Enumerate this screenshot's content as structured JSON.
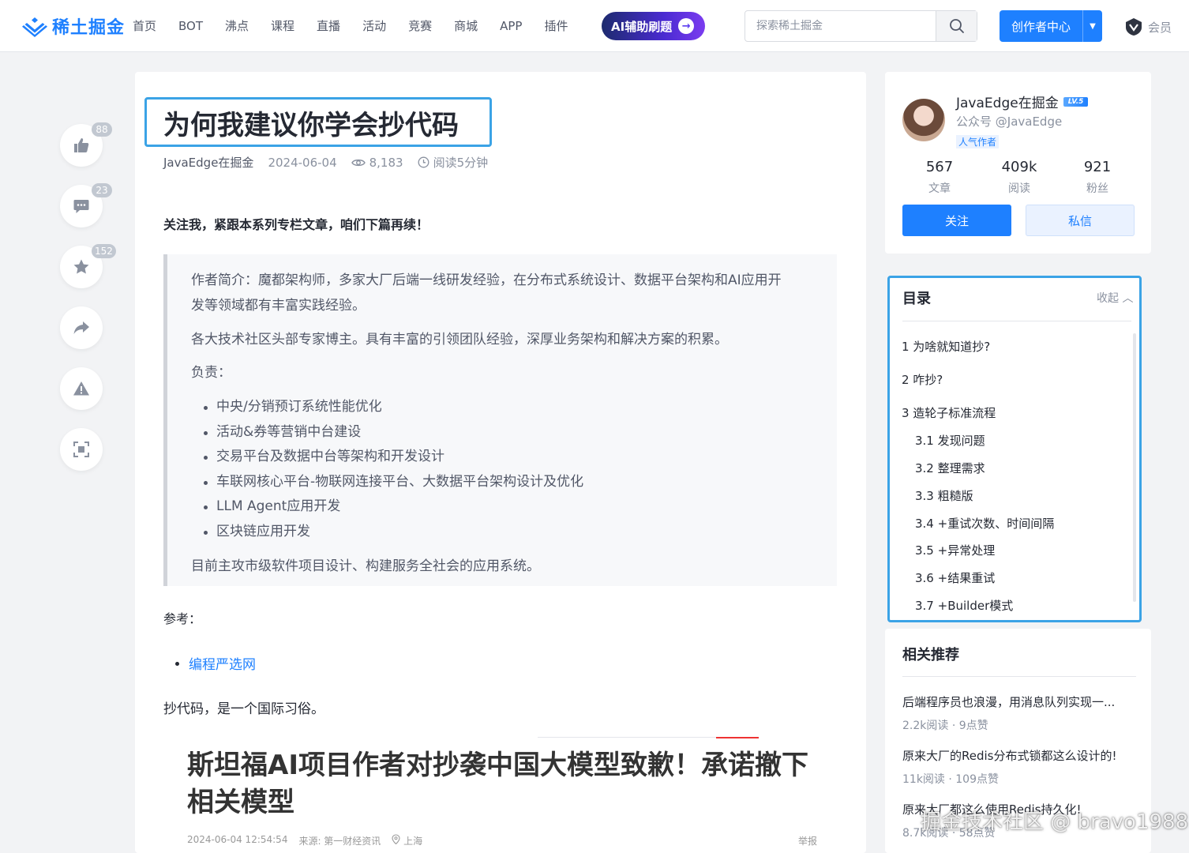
{
  "header": {
    "logo_text": "稀土掘金",
    "nav": [
      "首页",
      "BOT",
      "沸点",
      "课程",
      "直播",
      "活动",
      "竞赛",
      "商城",
      "APP",
      "插件"
    ],
    "ai_pill": "AI辅助刷题",
    "search_placeholder": "探索稀土掘金",
    "creator_button": "创作者中心",
    "vip_label": "会员"
  },
  "side_actions": [
    {
      "icon": "thumb-up-icon",
      "badge": "88"
    },
    {
      "icon": "comment-icon",
      "badge": "23"
    },
    {
      "icon": "star-icon",
      "badge": "152"
    },
    {
      "icon": "share-icon",
      "badge": ""
    },
    {
      "icon": "report-icon",
      "badge": ""
    },
    {
      "icon": "fullscreen-icon",
      "badge": ""
    }
  ],
  "article": {
    "title": "为何我建议你学会抄代码",
    "author": "JavaEdge在掘金",
    "date": "2024-06-04",
    "views": "8,183",
    "read_time": "阅读5分钟",
    "intro_bold": "关注我，紧跟本系列专栏文章，咱们下篇再续！",
    "quote": {
      "line1": "作者简介：魔都架构师，多家大厂后端一线研发经验，在分布式系统设计、数据平台架构和AI应用开",
      "line2": "发等领域都有丰富实践经验。",
      "line3": "各大技术社区头部专家博主。具有丰富的引领团队经验，深厚业务架构和解决方案的积累。",
      "line4": "负责：",
      "items": [
        "中央/分销预订系统性能优化",
        "活动&券等营销中台建设",
        "交易平台及数据中台等架构和开发设计",
        "车联网核心平台-物联网连接平台、大数据平台架构设计及优化",
        "LLM Agent应用开发",
        "区块链应用开发"
      ],
      "line5": "目前主攻市级软件项目设计、构建服务全社会的应用系统。"
    },
    "ref_label": "参考：",
    "ref_link": "编程严选网",
    "paragraph": "抄代码，是一个国际习俗。",
    "news": {
      "title": "斯坦福AI项目作者对抄袭中国大模型致歉！承诺撤下相关模型",
      "time": "2024-06-04 12:54:54",
      "source": "来源: 第一财经资讯",
      "location": "上海",
      "report": "举报"
    }
  },
  "author_card": {
    "name": "JavaEdge在掘金",
    "level": "LV.5",
    "sub": "公众号 @JavaEdge",
    "tag": "人气作者",
    "stats": [
      {
        "value": "567",
        "label": "文章"
      },
      {
        "value": "409k",
        "label": "阅读"
      },
      {
        "value": "921",
        "label": "粉丝"
      }
    ],
    "follow": "关注",
    "message": "私信"
  },
  "toc": {
    "title": "目录",
    "collapse": "收起",
    "items": [
      "1 为啥就知道抄?",
      "2 咋抄?",
      "3 造轮子标准流程",
      "3.1 发现问题",
      "3.2 整理需求",
      "3.3 粗糙版",
      "3.4 +重试次数、时间间隔",
      "3.5 +异常处理",
      "3.6 +结果重试",
      "3.7 +Builder模式"
    ]
  },
  "related": {
    "title": "相关推荐",
    "items": [
      {
        "title": "后端程序员也浪漫，用消息队列实现一...",
        "meta": "2.2k阅读 · 9点赞"
      },
      {
        "title": "原来大厂的Redis分布式锁都这么设计的!",
        "meta": "11k阅读 · 109点赞"
      },
      {
        "title": "原来大厂都这么使用Redis持久化!",
        "meta": "8.7k阅读 · 58点赞"
      }
    ]
  },
  "watermark": "掘金技术社区 @ bravo1988",
  "colors": {
    "brand": "#1e80ff",
    "highlight_border": "#3ba3e6"
  }
}
